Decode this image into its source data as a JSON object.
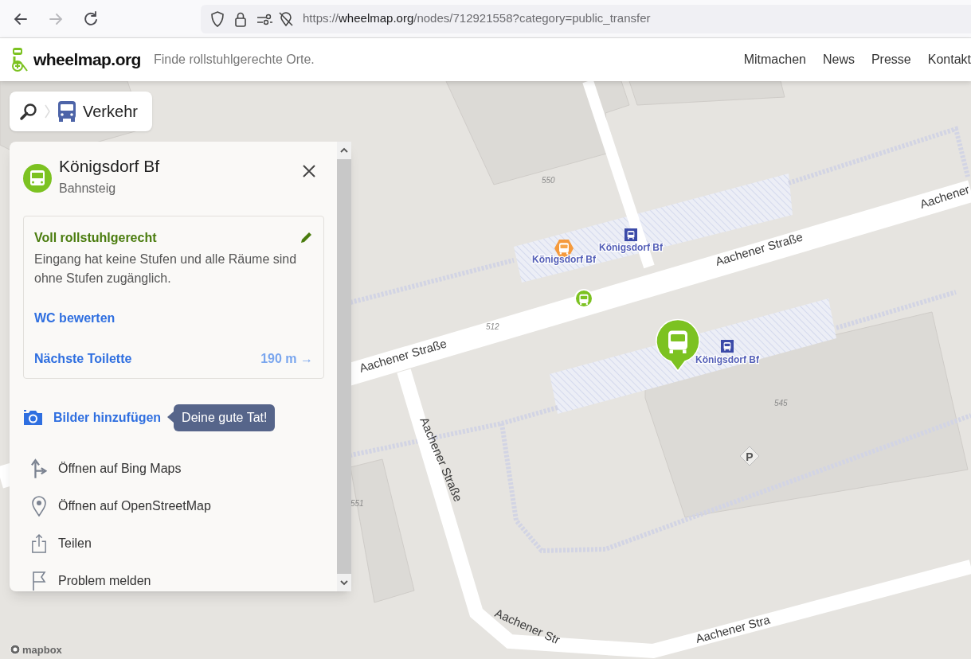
{
  "browser": {
    "nav_buttons": [
      {
        "kind": "back",
        "disabled": false
      },
      {
        "kind": "forward",
        "disabled": true
      },
      {
        "kind": "reload",
        "disabled": false
      }
    ],
    "url": "https://**wheelmap.org**/nodes/712921558?category=public_transfer"
  },
  "header": {
    "logo_text": "wheelmap.org",
    "tagline": "Finde rollstuhlgerechte Orte.",
    "nav": [
      "Mitmachen",
      "News",
      "Presse",
      "Kontakt"
    ]
  },
  "breadcrumb": {
    "category": "Verkehr"
  },
  "panel": {
    "title": "Königsdorf Bf",
    "subtitle": "Bahnsteig",
    "accessibility": {
      "status": "Voll rollstuhlgerecht",
      "color": "#4a7c0e",
      "description": "Eingang hat keine Stufen und alle Räume sind ohne Stufen zugänglich."
    },
    "wc_link": "WC bewerten",
    "toilet": {
      "label": "Nächste Toilette",
      "distance": "190 m →"
    },
    "add_photos": {
      "label": "Bilder hinzufügen",
      "tooltip": "Deine gute Tat!"
    },
    "actions": [
      {
        "kind": "directions",
        "label": "Öffnen auf Bing Maps"
      },
      {
        "kind": "pin",
        "label": "Öffnen auf OpenStreetMap"
      },
      {
        "kind": "share",
        "label": "Teilen"
      },
      {
        "kind": "flag",
        "label": "Problem melden"
      }
    ]
  },
  "map": {
    "street_labels": [
      "Aachener",
      "Aachener Straße",
      "Aachener Straße",
      "Aachener Straße",
      "Aachener Str",
      "Aachener Stra"
    ],
    "house_numbers": [
      "550",
      "512",
      "545",
      "551"
    ],
    "parking": "P",
    "stops": [
      {
        "kind": "orange",
        "label": "Königsdorf Bf"
      },
      {
        "kind": "blue",
        "label": "Königsdorf Bf"
      },
      {
        "kind": "blue",
        "label": "Königsdorf Bf"
      }
    ],
    "attribution": "mapbox"
  }
}
